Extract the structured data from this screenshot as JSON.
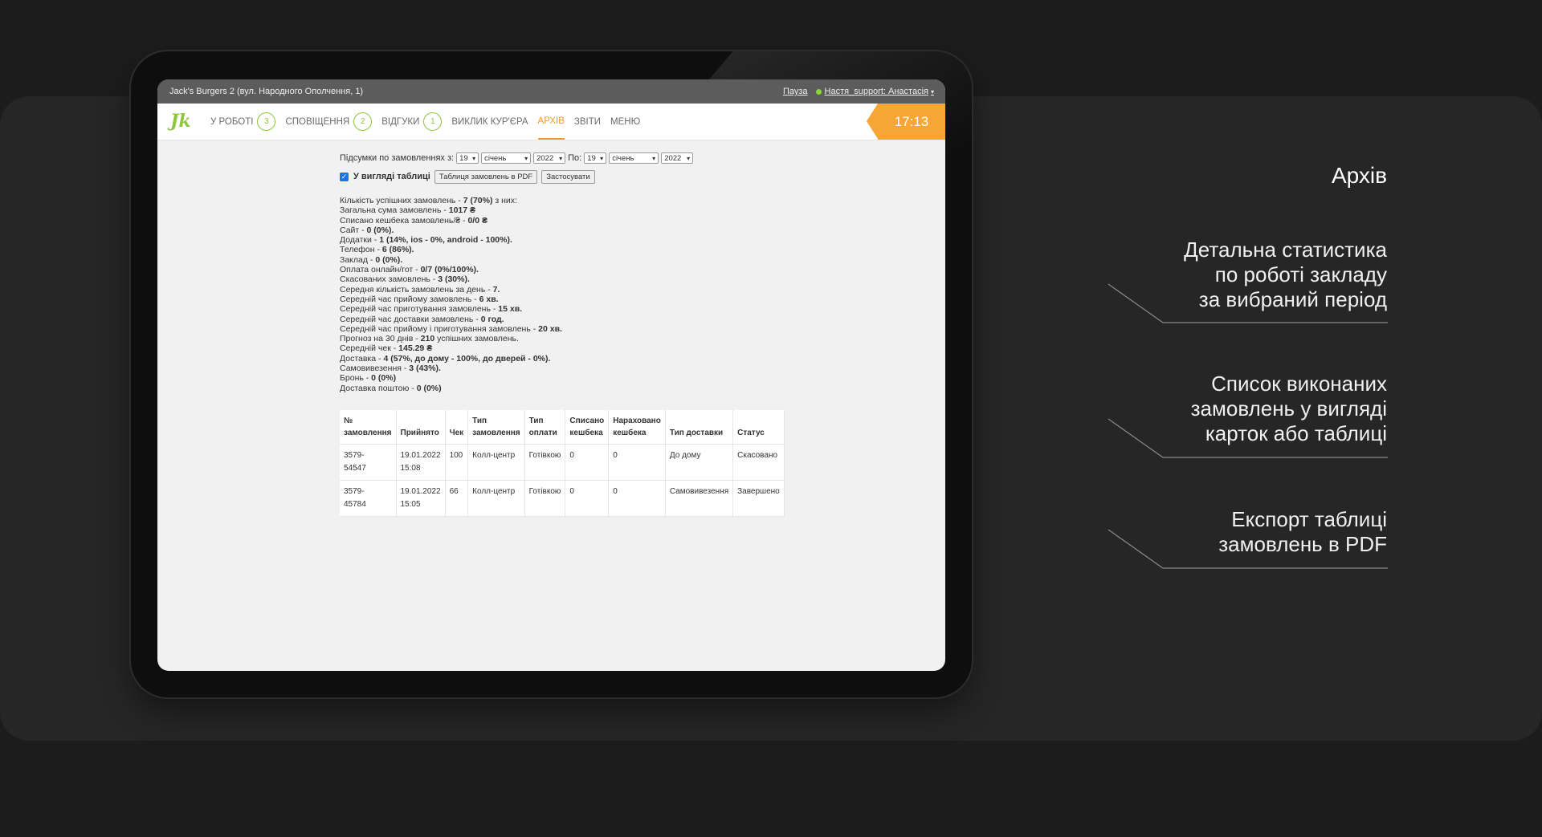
{
  "window": {
    "venue": "Jack's Burgers 2 (вул. Народного Ополчення, 1)",
    "pause_label": "Пауза",
    "user_label": "Настя_support: Анастасія",
    "clock": "17:13"
  },
  "nav": {
    "logo": "Jk",
    "items": [
      {
        "label": "У РОБОТІ",
        "badge": "3"
      },
      {
        "label": "СПОВІЩЕННЯ",
        "badge": "2"
      },
      {
        "label": "ВІДГУКИ",
        "badge": "1"
      },
      {
        "label": "ВИКЛИК КУР'ЄРА"
      },
      {
        "label": "АРХІВ",
        "active": true
      },
      {
        "label": "ЗВІТИ"
      },
      {
        "label": "МЕНЮ"
      }
    ]
  },
  "filter": {
    "label_from": "Підсумки по замовленнях з:",
    "from_day": "19",
    "from_month": "січень",
    "from_year": "2022",
    "label_to": "По:",
    "to_day": "19",
    "to_month": "січень",
    "to_year": "2022",
    "table_view_label": "У вигляді таблиці",
    "table_view_checked": true,
    "pdf_button": "Таблиця замовлень в PDF",
    "apply_button": "Застосувати"
  },
  "stats": [
    {
      "label": "Кількість успішних замовлень - ",
      "value": "7 (70%)",
      "suffix": " з них:"
    },
    {
      "label": "Загальна сума замовлень - ",
      "value": "1017 ₴"
    },
    {
      "label": "Списано кешбека замовлень/₴ - ",
      "value": "0/0 ₴"
    },
    {
      "label": "Сайт - ",
      "value": "0 (0%)."
    },
    {
      "label": "Додатки - ",
      "value": "1 (14%, ios - 0%, android - 100%)."
    },
    {
      "label": "Телефон - ",
      "value": "6 (86%)."
    },
    {
      "label": "Заклад - ",
      "value": "0 (0%)."
    },
    {
      "label": "Оплата онлайн/гот - ",
      "value": "0/7 (0%/100%)."
    },
    {
      "label": "Скасованих замовлень - ",
      "value": "3 (30%)."
    },
    {
      "label": "Середня кількість замовлень за день - ",
      "value": "7."
    },
    {
      "label": "Середній час прийому замовлень - ",
      "value": "6 хв."
    },
    {
      "label": "Середній час приготування замовлень - ",
      "value": "15 хв."
    },
    {
      "label": "Середній час доставки замовлень - ",
      "value": "0 год."
    },
    {
      "label": "Середній час прийому і приготування замовлень - ",
      "value": "20 хв."
    },
    {
      "label": "Прогноз на 30 днів - ",
      "value": "210",
      "suffix": " успішних замовлень."
    },
    {
      "label": "Середній чек - ",
      "value": "145.29 ₴"
    },
    {
      "label": "Доставка - ",
      "value": "4 (57%, до дому - 100%, до дверей - 0%)."
    },
    {
      "label": "Самовивезення - ",
      "value": "3 (43%)."
    },
    {
      "label": "Бронь - ",
      "value": "0 (0%)"
    },
    {
      "label": "Доставка поштою - ",
      "value": "0 (0%)"
    }
  ],
  "table": {
    "headers": [
      [
        "№",
        "замовлення"
      ],
      [
        "Прийнято"
      ],
      [
        "Чек"
      ],
      [
        "Тип",
        "замовлення"
      ],
      [
        "Тип",
        "оплати"
      ],
      [
        "Списано",
        "кешбека"
      ],
      [
        "Нараховано",
        "кешбека"
      ],
      [
        "Тип доставки"
      ],
      [
        "Статус"
      ]
    ],
    "rows": [
      [
        [
          "3579-",
          "54547"
        ],
        [
          "19.01.2022",
          "15:08"
        ],
        [
          "100"
        ],
        [
          "Колл-центр"
        ],
        [
          "Готівкою"
        ],
        [
          "0"
        ],
        [
          "0"
        ],
        [
          "До дому"
        ],
        [
          "Скасовано"
        ]
      ],
      [
        [
          "3579-",
          "45784"
        ],
        [
          "19.01.2022",
          "15:05"
        ],
        [
          "66"
        ],
        [
          "Колл-центр"
        ],
        [
          "Готівкою"
        ],
        [
          "0"
        ],
        [
          "0"
        ],
        [
          "Самовивезення"
        ],
        [
          "Завершено"
        ]
      ]
    ]
  },
  "side": {
    "title": "Архів",
    "notes": [
      [
        "Детальна статистика",
        "по роботі закладу",
        "за вибраний період"
      ],
      [
        "Список виконаних",
        "замовлень у вигляді",
        "карток або таблиці"
      ],
      [
        "Експорт таблиці",
        "замовлень в PDF"
      ]
    ]
  }
}
